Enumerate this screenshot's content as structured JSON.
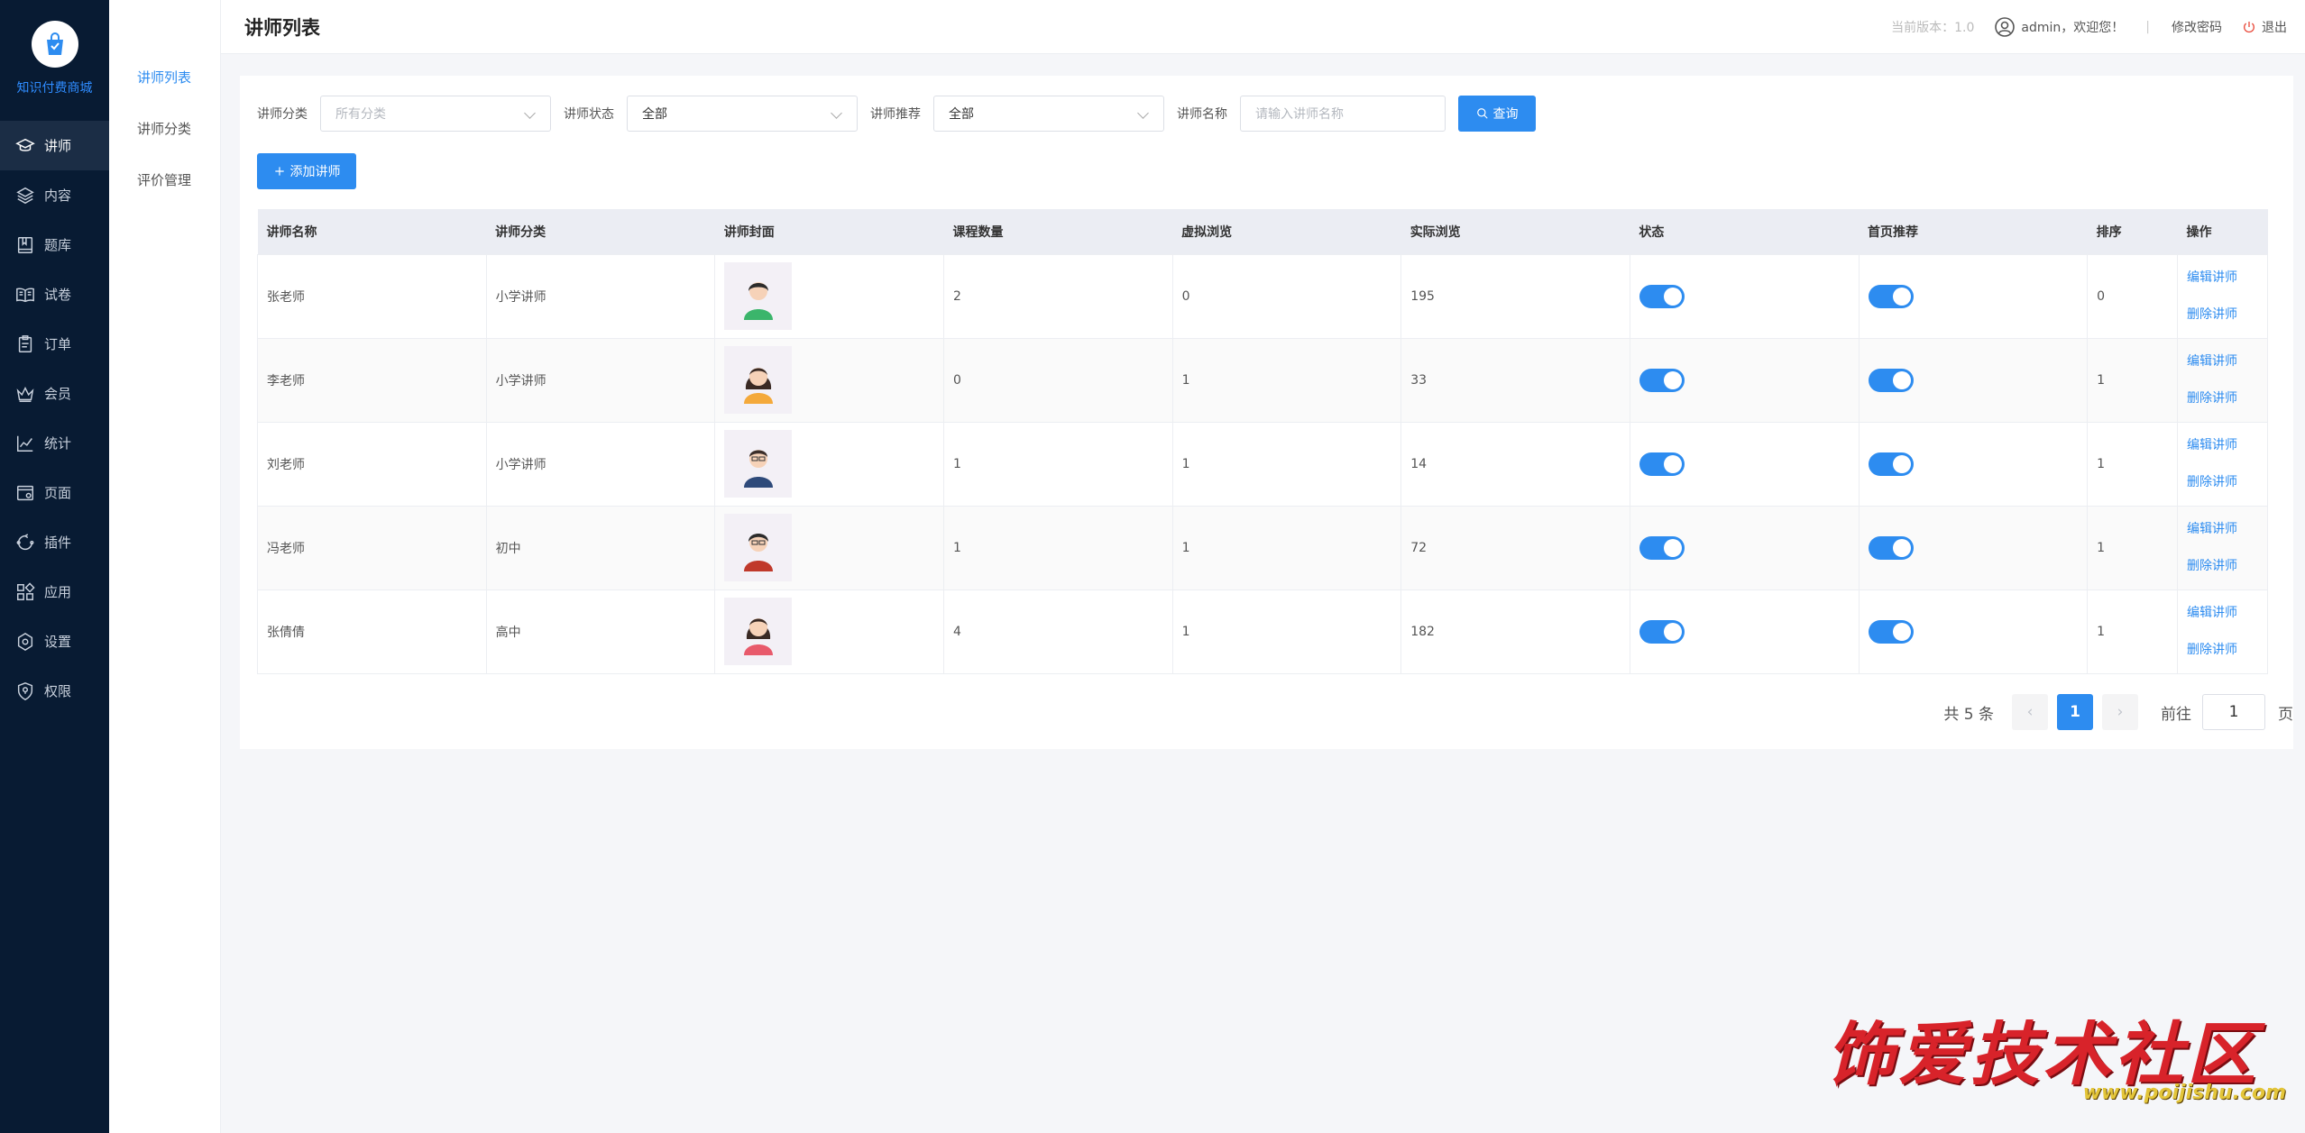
{
  "app": {
    "name": "知识付费商城"
  },
  "sidebar": {
    "items": [
      {
        "label": "讲师",
        "icon": "graduation-cap-icon",
        "active": true
      },
      {
        "label": "内容",
        "icon": "layers-icon",
        "active": false
      },
      {
        "label": "题库",
        "icon": "book-icon",
        "active": false
      },
      {
        "label": "试卷",
        "icon": "open-book-icon",
        "active": false
      },
      {
        "label": "订单",
        "icon": "clipboard-icon",
        "active": false
      },
      {
        "label": "会员",
        "icon": "crown-icon",
        "active": false
      },
      {
        "label": "统计",
        "icon": "line-chart-icon",
        "active": false
      },
      {
        "label": "页面",
        "icon": "page-icon",
        "active": false
      },
      {
        "label": "插件",
        "icon": "plugin-icon",
        "active": false
      },
      {
        "label": "应用",
        "icon": "apps-icon",
        "active": false
      },
      {
        "label": "设置",
        "icon": "gear-icon",
        "active": false
      },
      {
        "label": "权限",
        "icon": "shield-icon",
        "active": false
      }
    ]
  },
  "submenu": {
    "items": [
      {
        "label": "讲师列表",
        "active": true
      },
      {
        "label": "讲师分类",
        "active": false
      },
      {
        "label": "评价管理",
        "active": false
      }
    ]
  },
  "header": {
    "title": "讲师列表",
    "version": "当前版本：1.0",
    "user": "admin，欢迎您！",
    "divider": "|",
    "change_password": "修改密码",
    "logout": "退出"
  },
  "filters": {
    "category_label": "讲师分类",
    "category_placeholder": "所有分类",
    "status_label": "讲师状态",
    "status_value": "全部",
    "recommend_label": "讲师推荐",
    "recommend_value": "全部",
    "name_label": "讲师名称",
    "name_placeholder": "请输入讲师名称",
    "query_button": "查询"
  },
  "add_button": "添加讲师",
  "table": {
    "headers": [
      "讲师名称",
      "讲师分类",
      "讲师封面",
      "课程数量",
      "虚拟浏览",
      "实际浏览",
      "状态",
      "首页推荐",
      "排序",
      "操作"
    ],
    "rows": [
      {
        "name": "张老师",
        "category": "小学讲师",
        "courses": "2",
        "virtual_views": "0",
        "real_views": "195",
        "status": true,
        "recommend": true,
        "sort": "0",
        "edit": "编辑讲师",
        "delete": "删除讲师"
      },
      {
        "name": "李老师",
        "category": "小学讲师",
        "courses": "0",
        "virtual_views": "1",
        "real_views": "33",
        "status": true,
        "recommend": true,
        "sort": "1",
        "edit": "编辑讲师",
        "delete": "删除讲师"
      },
      {
        "name": "刘老师",
        "category": "小学讲师",
        "courses": "1",
        "virtual_views": "1",
        "real_views": "14",
        "status": true,
        "recommend": true,
        "sort": "1",
        "edit": "编辑讲师",
        "delete": "删除讲师"
      },
      {
        "name": "冯老师",
        "category": "初中",
        "courses": "1",
        "virtual_views": "1",
        "real_views": "72",
        "status": true,
        "recommend": true,
        "sort": "1",
        "edit": "编辑讲师",
        "delete": "删除讲师"
      },
      {
        "name": "张倩倩",
        "category": "高中",
        "courses": "4",
        "virtual_views": "1",
        "real_views": "182",
        "status": true,
        "recommend": true,
        "sort": "1",
        "edit": "编辑讲师",
        "delete": "删除讲师"
      }
    ]
  },
  "pagination": {
    "total": "共 5 条",
    "prev": "‹",
    "current": "1",
    "next": "›",
    "goto_label": "前往",
    "goto_value": "1",
    "page_suffix": "页"
  },
  "watermark": {
    "main": "饰爱技术社区",
    "url": "www.poijishu.com"
  },
  "colors": {
    "sidebar_bg": "#081b33",
    "primary": "#2d8cf0",
    "page_bg": "#f5f6f9"
  }
}
